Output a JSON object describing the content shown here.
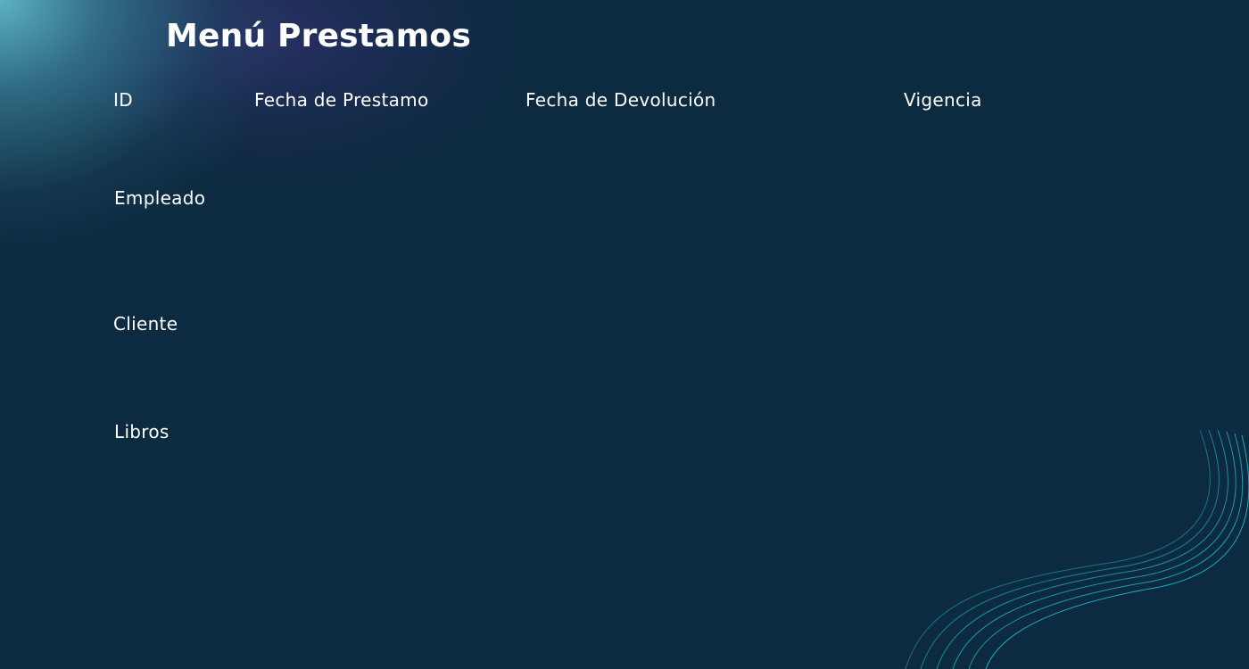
{
  "page": {
    "title": "Menú Prestamos"
  },
  "fields": {
    "id": "ID",
    "fecha_prestamo": "Fecha de Prestamo",
    "fecha_devolucion": "Fecha de Devolución",
    "vigencia": "Vigencia",
    "empleado": "Empleado",
    "cliente": "Cliente",
    "libros": "Libros"
  },
  "colors": {
    "background": "#0c2a40",
    "glow": "#5fb9c8",
    "wave_lines": "#1fb3c4",
    "text": "#ffffff"
  }
}
